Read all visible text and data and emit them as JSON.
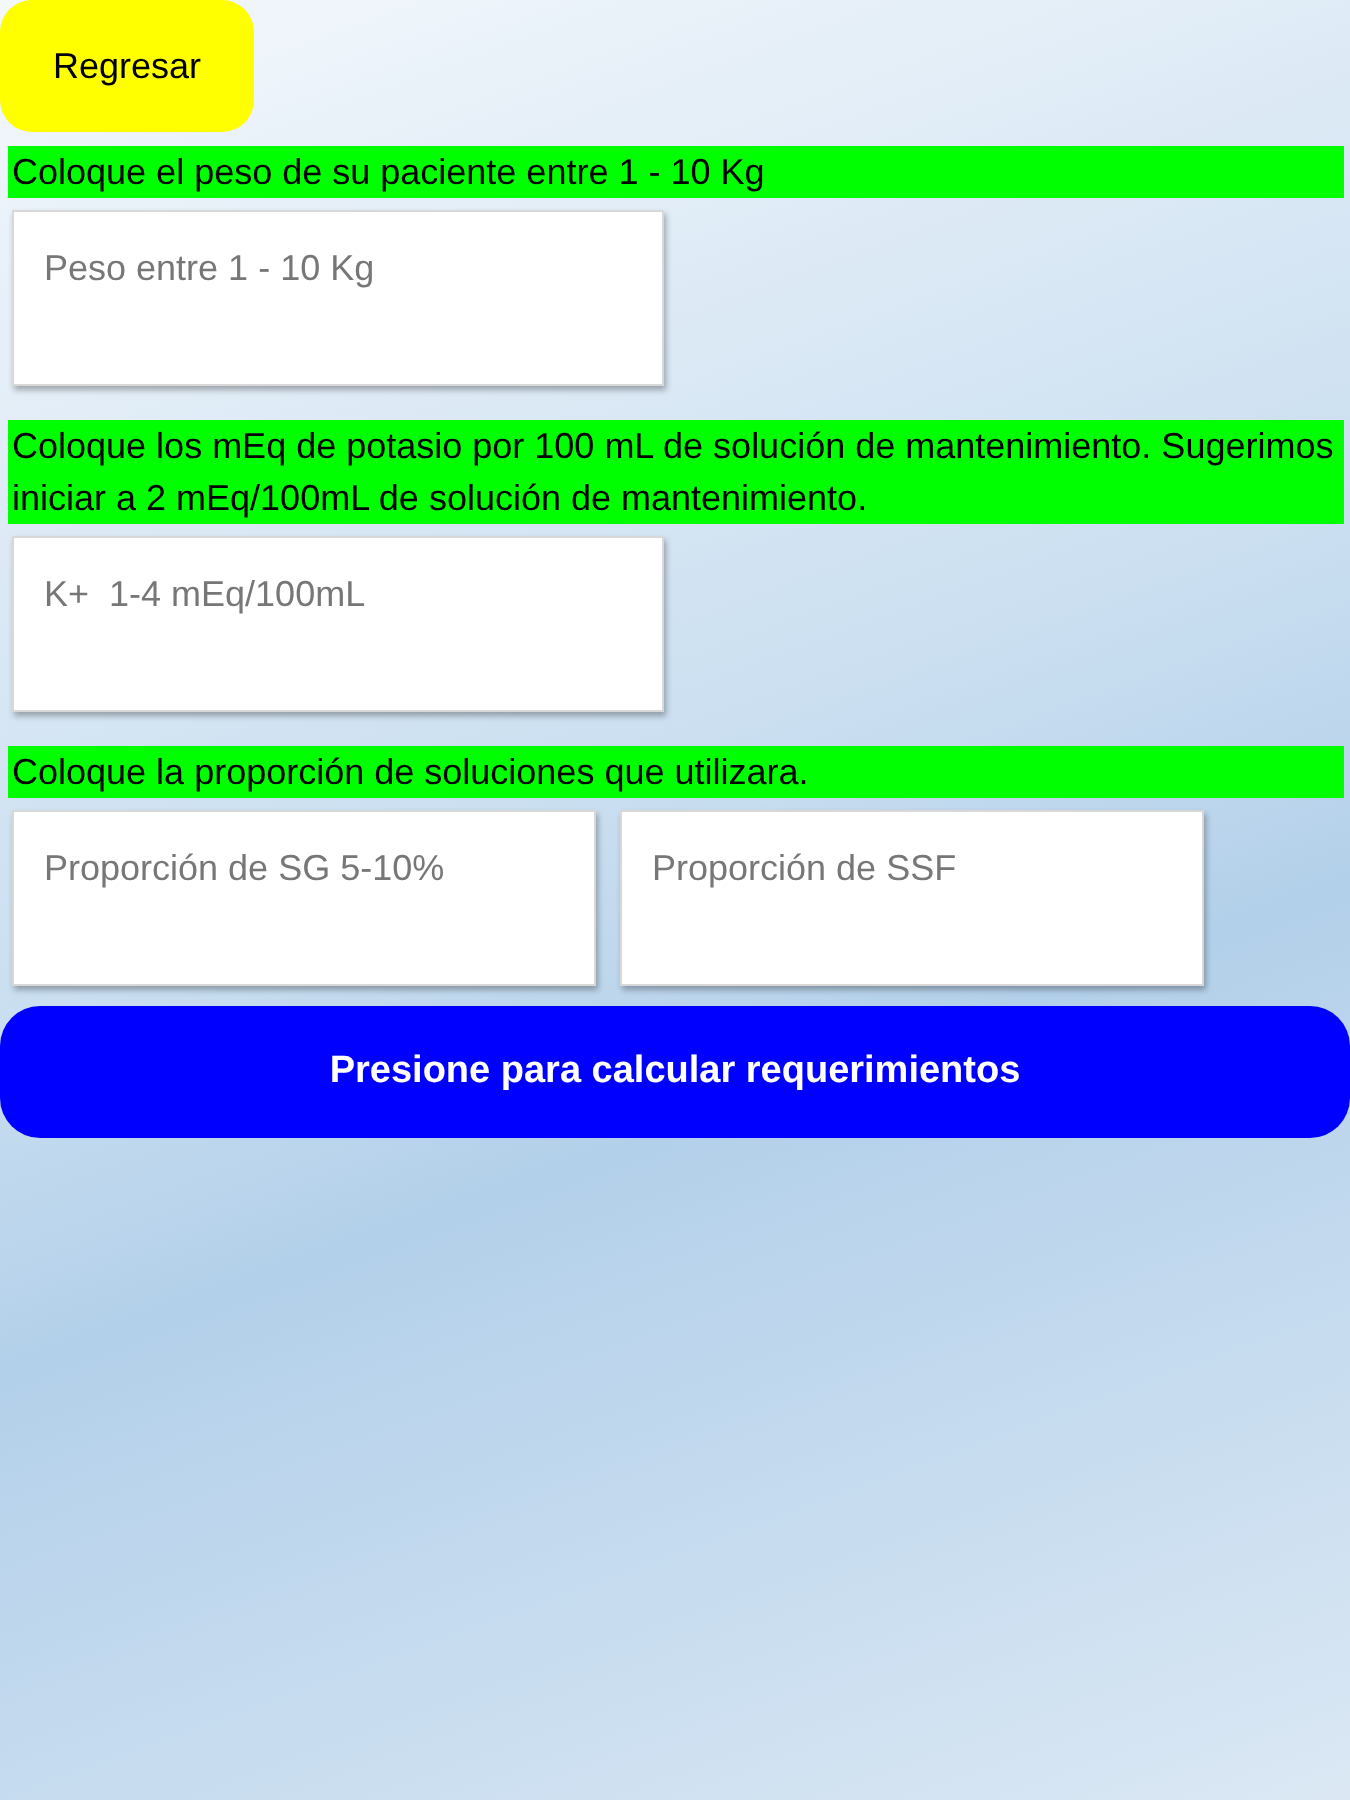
{
  "back_button": {
    "label": "Regresar"
  },
  "sections": [
    {
      "prompt": "Coloque el peso de su paciente entre 1 - 10 Kg",
      "fields": [
        {
          "placeholder": "Peso entre 1 - 10 Kg"
        }
      ]
    },
    {
      "prompt": "Coloque los mEq de potasio por 100 mL de solución de mantenimiento. Sugerimos iniciar a 2 mEq/100mL de solución de mantenimiento.",
      "fields": [
        {
          "placeholder": "K+  1-4 mEq/100mL"
        }
      ]
    },
    {
      "prompt": "Coloque la proporción de soluciones que utilizara.",
      "fields": [
        {
          "placeholder": "Proporción de SG 5-10%"
        },
        {
          "placeholder": "Proporción de SSF"
        }
      ]
    }
  ],
  "calculate_button": {
    "label": "Presione para calcular requerimientos"
  }
}
